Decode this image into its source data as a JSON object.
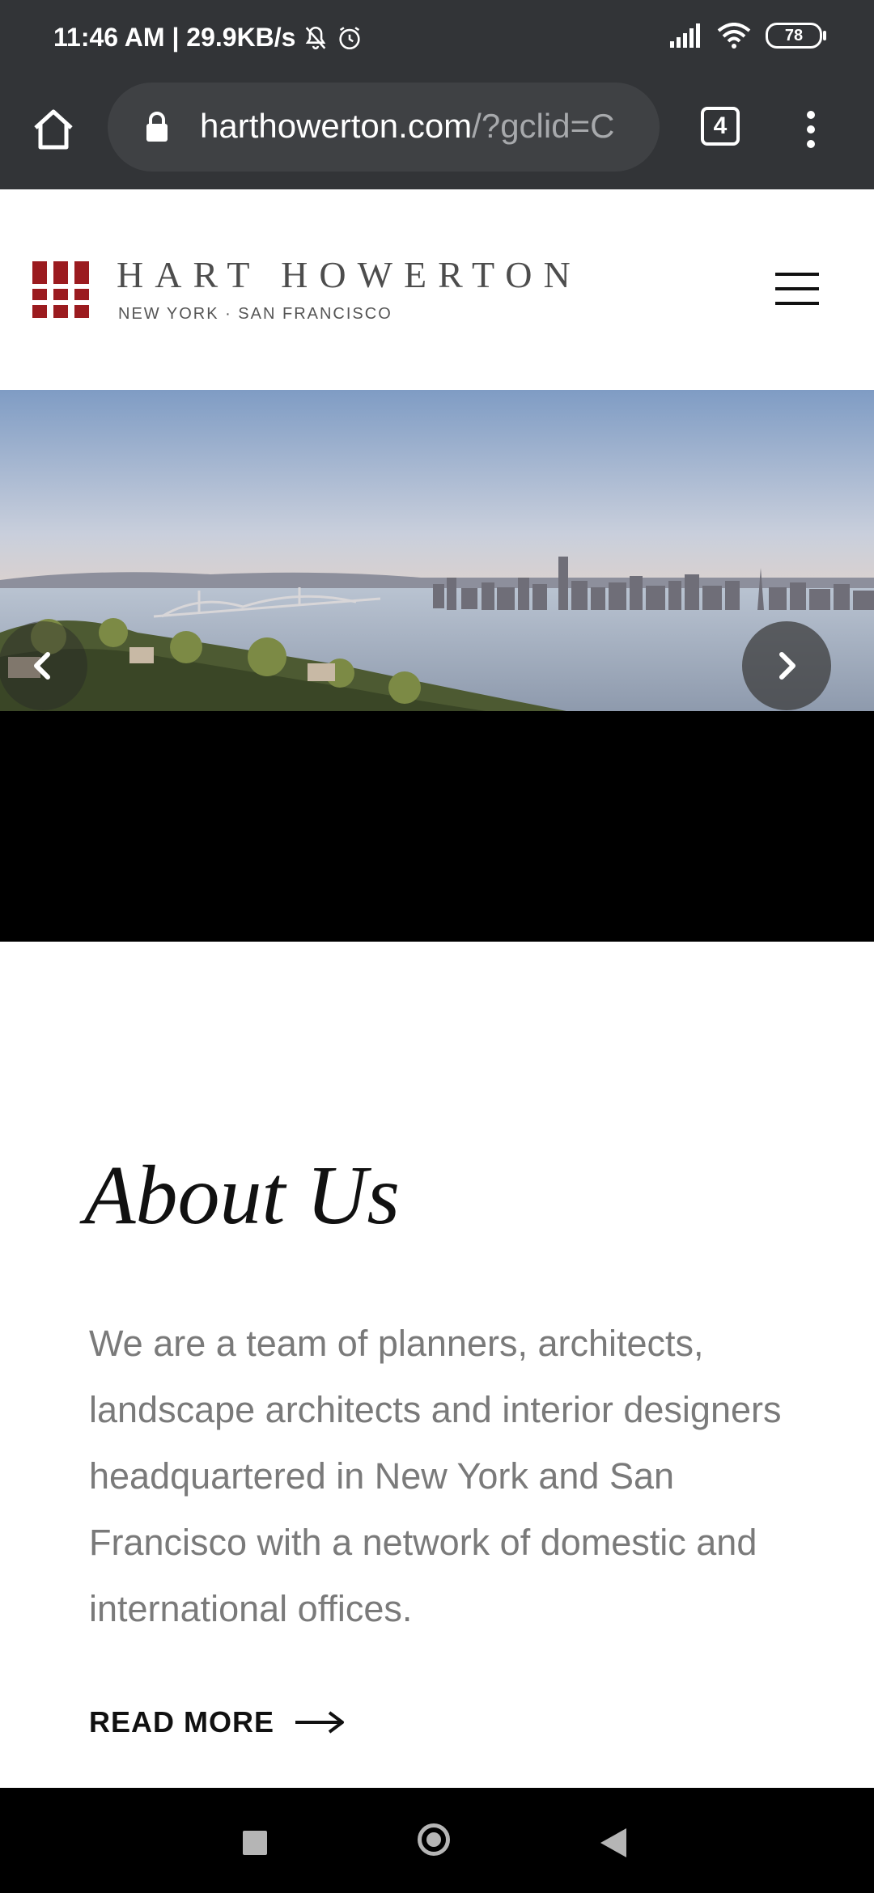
{
  "status_bar": {
    "time_speed": "11:46 AM | 29.9KB/s",
    "battery": "78"
  },
  "browser": {
    "url_main": "harthowerton.com",
    "url_rest": "/?gclid=C",
    "tab_count": "4"
  },
  "site": {
    "brand_name": "HART HOWERTON",
    "brand_tagline": "NEW YORK · SAN FRANCISCO",
    "brand_color": "#9b1b1f"
  },
  "about": {
    "title": "About Us",
    "body": "We are a team of planners, architects, landscape architects and interior designers headquartered in New York and San Francisco with a network of domestic and international offices.",
    "read_more": "READ MORE"
  }
}
